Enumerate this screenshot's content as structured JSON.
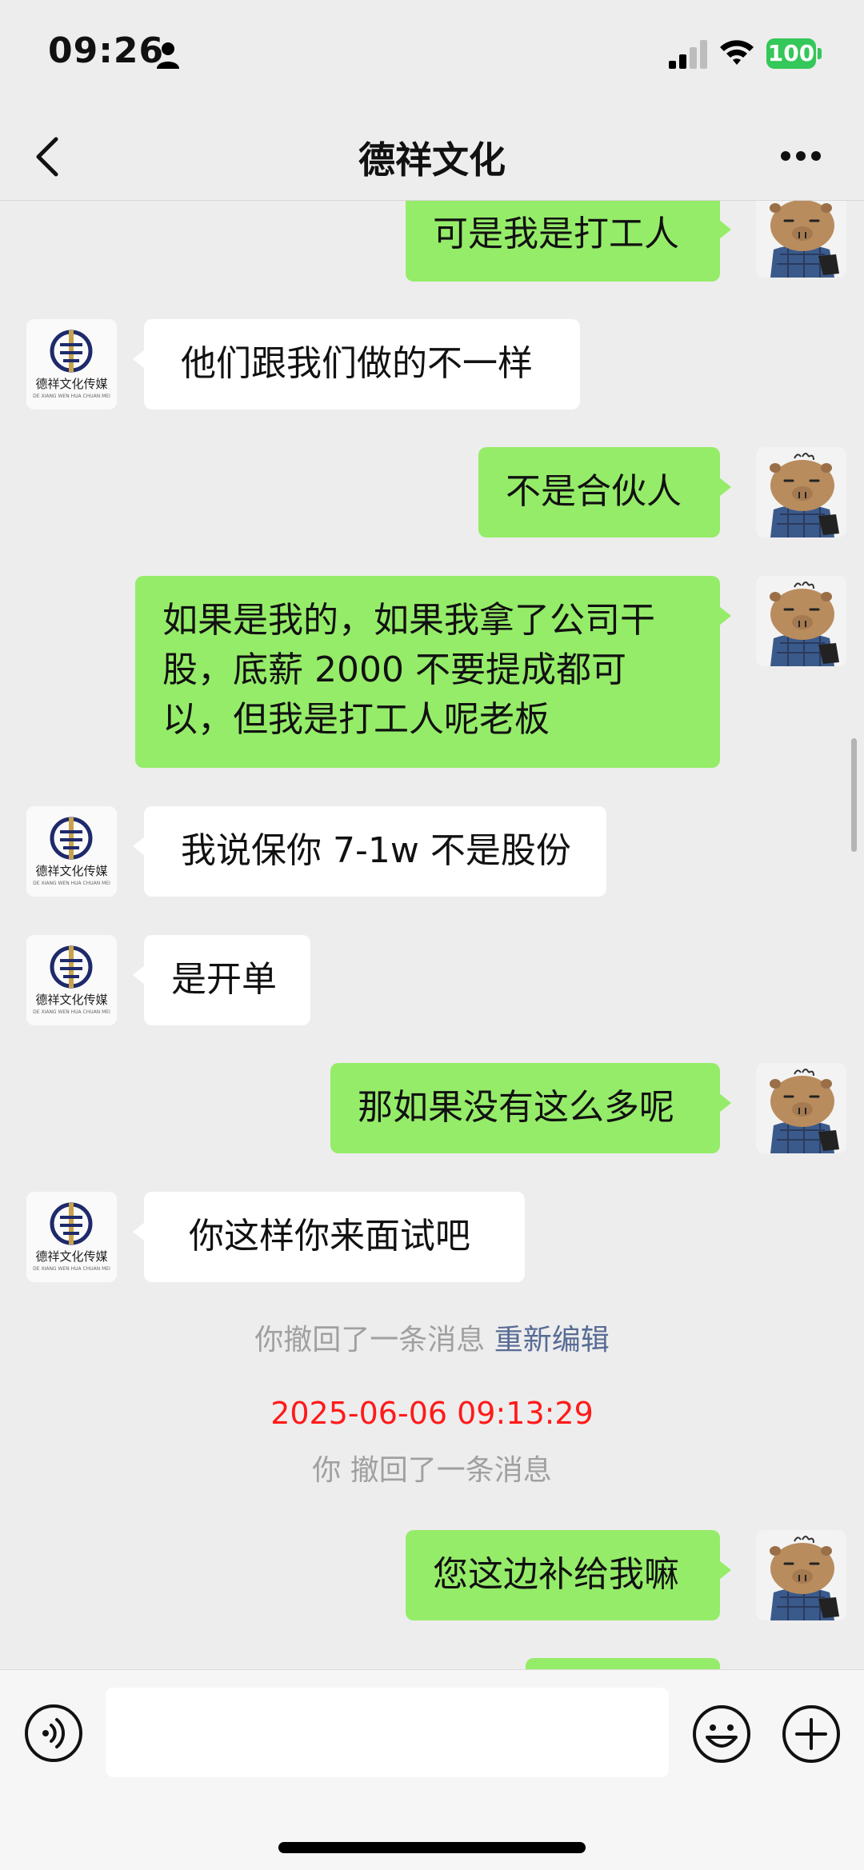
{
  "status_bar": {
    "time": "09:26",
    "battery": "100"
  },
  "header": {
    "title": "德祥文化"
  },
  "messages": [
    {
      "side": "out",
      "text": "可是我是打工人"
    },
    {
      "side": "in",
      "text": "他们跟我们做的不一样"
    },
    {
      "side": "out",
      "text": "不是合伙人"
    },
    {
      "side": "out",
      "text": "如果是我的，如果我拿了公司干股，底薪 2000 不要提成都可以，但我是打工人呢老板"
    },
    {
      "side": "in",
      "text": "我说保你 7-1w 不是股份"
    },
    {
      "side": "in",
      "text": "是开单"
    },
    {
      "side": "out",
      "text": "那如果没有这么多呢"
    },
    {
      "side": "in",
      "text": "你这样你来面试吧"
    },
    {
      "side": "out",
      "text": "您这边补给我嘛"
    }
  ],
  "system": {
    "recalled_notice": "你撤回了一条消息",
    "reedit_label": "重新编辑",
    "timestamp": "2025-06-06 09:13:29",
    "recalled_notice_2": "你 撤回了一条消息"
  },
  "company_avatar": {
    "label": "德祥文化传媒",
    "sub": "DE XIANG WEN HUA CHUAN MEI",
    "color": "#1f2a6b",
    "accent": "#c8a24a"
  },
  "colors": {
    "out_bubble": "#95ec69",
    "in_bubble": "#ffffff",
    "background": "#ededed",
    "timestamp": "#ff1a1a",
    "link": "#576b95"
  },
  "input": {
    "placeholder": ""
  }
}
